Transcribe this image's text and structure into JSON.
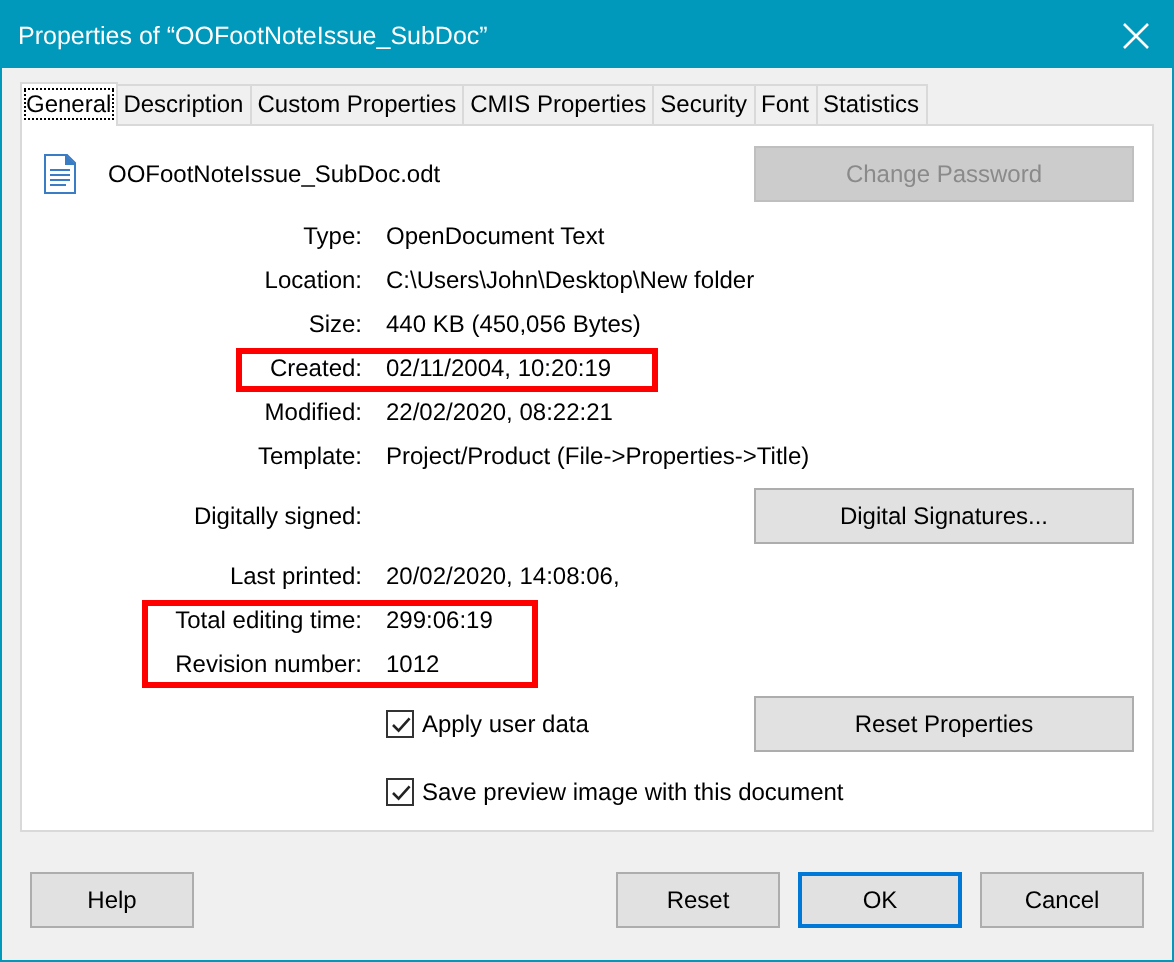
{
  "window": {
    "title": "Properties of “OOFootNoteIssue_SubDoc”"
  },
  "tabs": [
    {
      "label": "General",
      "selected": true
    },
    {
      "label": "Description",
      "selected": false
    },
    {
      "label": "Custom Properties",
      "selected": false
    },
    {
      "label": "CMIS Properties",
      "selected": false
    },
    {
      "label": "Security",
      "selected": false
    },
    {
      "label": "Font",
      "selected": false
    },
    {
      "label": "Statistics",
      "selected": false
    }
  ],
  "file": {
    "name": "OOFootNoteIssue_SubDoc.odt"
  },
  "change_password_button": {
    "label": "Change Password",
    "disabled": true
  },
  "fields": [
    {
      "kind": "text",
      "label": "Type:",
      "value": "OpenDocument Text",
      "highlighted": false
    },
    {
      "kind": "text",
      "label": "Location:",
      "value": "C:\\Users\\John\\Desktop\\New folder",
      "highlighted": false
    },
    {
      "kind": "text",
      "label": "Size:",
      "value": "440 KB (450,056 Bytes)",
      "highlighted": false
    },
    {
      "kind": "text",
      "label": "Created:",
      "value": "02/11/2004, 10:20:19",
      "highlighted": true
    },
    {
      "kind": "text",
      "label": "Modified:",
      "value": "22/02/2020, 08:22:21",
      "highlighted": false
    },
    {
      "kind": "text",
      "label": "Template:",
      "value": "Project/Product (File->Properties->Title)",
      "highlighted": false
    },
    {
      "kind": "button",
      "label": "Digitally signed:",
      "button": "Digital Signatures...",
      "highlighted": false
    },
    {
      "kind": "text",
      "label": "Last printed:",
      "value": "20/02/2020, 14:08:06,",
      "highlighted": false
    },
    {
      "kind": "text",
      "label": "Total editing time:",
      "value": "299:06:19",
      "highlighted": true
    },
    {
      "kind": "text",
      "label": "Revision number:",
      "value": "1012",
      "highlighted": true
    }
  ],
  "checkboxes": [
    {
      "label": "Apply user data",
      "checked": true
    },
    {
      "label": "Save preview image with this document",
      "checked": true
    }
  ],
  "reset_properties_button": "Reset Properties",
  "buttons": [
    {
      "label": "Help",
      "default": false
    },
    {
      "label": "Reset",
      "default": false
    },
    {
      "label": "OK",
      "default": true
    },
    {
      "label": "Cancel",
      "default": false
    }
  ]
}
